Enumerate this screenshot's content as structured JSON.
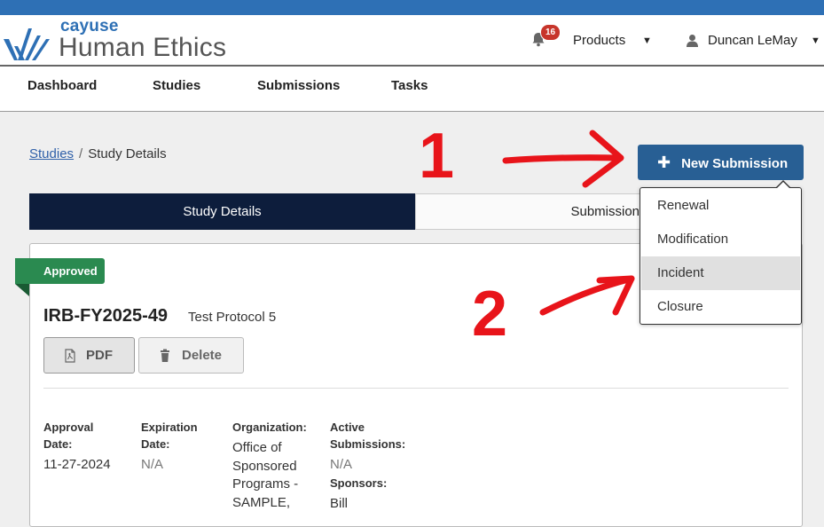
{
  "header": {
    "brand": "cayuse",
    "product": "Human Ethics",
    "notification_count": "16",
    "products_label": "Products",
    "user_name": "Duncan LeMay",
    "accent_color": "#2e70b5"
  },
  "nav": {
    "items": [
      {
        "label": "Dashboard"
      },
      {
        "label": "Studies"
      },
      {
        "label": "Submissions"
      },
      {
        "label": "Tasks"
      }
    ]
  },
  "breadcrumb": {
    "parent": "Studies",
    "separator": "/",
    "current": "Study Details"
  },
  "new_submission": {
    "label": "New Submission",
    "menu": [
      {
        "label": "Renewal"
      },
      {
        "label": "Modification"
      },
      {
        "label": "Incident"
      },
      {
        "label": "Closure"
      }
    ]
  },
  "tabs": [
    {
      "label": "Study Details"
    },
    {
      "label": "Submissions"
    }
  ],
  "study": {
    "status": "Approved",
    "status_color": "#2a8a50",
    "irb_number": "IRB-FY2025-49",
    "protocol_title": "Test Protocol 5",
    "pdf_label": "PDF",
    "delete_label": "Delete",
    "fields": {
      "approval_date_label_1": "Approval",
      "approval_date_label_2": "Date:",
      "approval_date": "11-27-2024",
      "expiration_date_label_1": "Expiration",
      "expiration_date_label_2": "Date:",
      "expiration_date": "N/A",
      "organization_label": "Organization:",
      "organization_lines": [
        "Office of",
        "Sponsored",
        "Programs -",
        "SAMPLE,"
      ],
      "active_submissions_label_1": "Active",
      "active_submissions_label_2": "Submissions:",
      "active_submissions": "N/A",
      "sponsors_label": "Sponsors:",
      "sponsors": "Bill"
    }
  },
  "annotations": {
    "first": "1",
    "second": "2",
    "color": "#e8141a"
  }
}
